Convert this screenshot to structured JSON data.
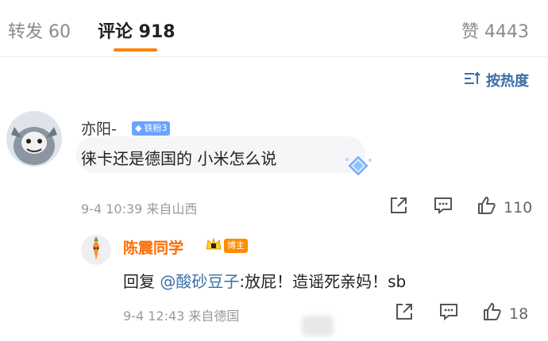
{
  "tabs": [
    {
      "label": "转发 60",
      "active": false
    },
    {
      "label": "评论 918",
      "active": true
    },
    {
      "label": "赞 4443",
      "active": false
    }
  ],
  "sort_label": "按热度",
  "comments": [
    {
      "username": "亦阳-",
      "badge": "铁粉3",
      "text": "徕卡还是德国的 小米怎么说",
      "meta": "9-4 10:39  来自山西",
      "likes": "110"
    }
  ],
  "reply": {
    "username": "陈震同学",
    "badge": "博主",
    "prefix": "回复 ",
    "mention": "@酸砂豆子",
    "text": ":放屁！造谣死亲妈！sb",
    "meta": "9-4 12:43  来自德国",
    "likes": "18"
  },
  "colors": {
    "accent": "#ff8200",
    "link": "#3a6ea5",
    "badge_blue": "#6ba3ff",
    "badge_orange": "#ff8c00"
  }
}
